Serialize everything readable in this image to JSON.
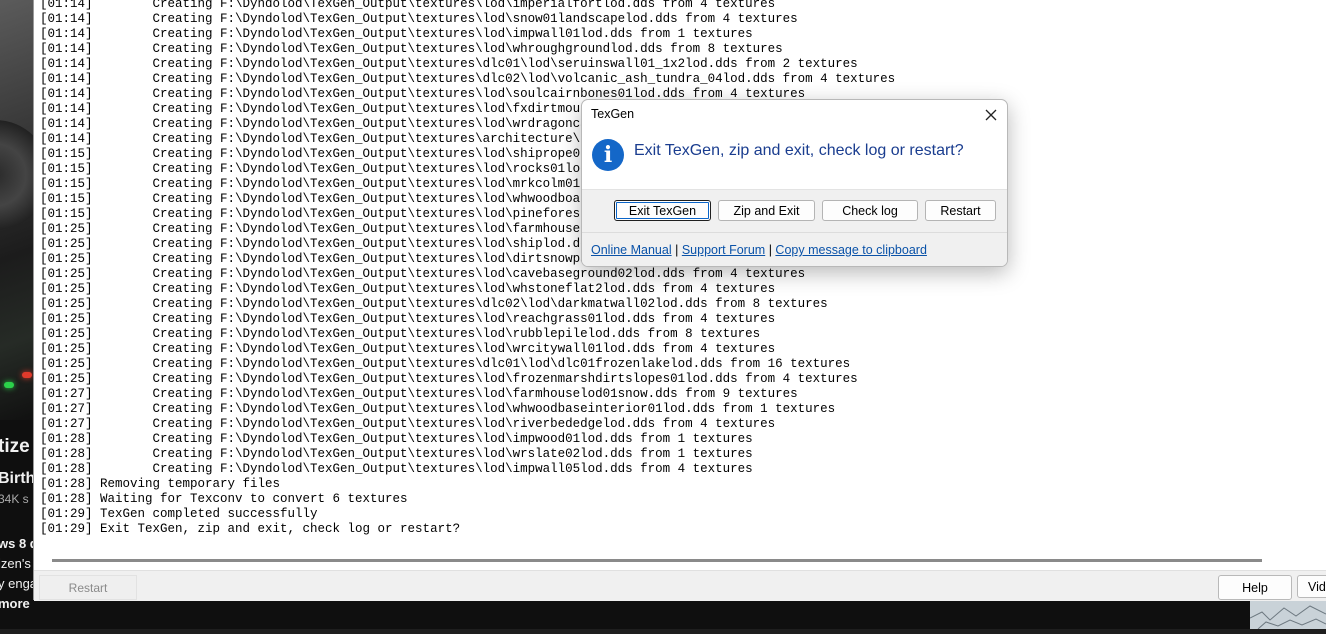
{
  "background": {
    "video_title_fragment": "tize",
    "subtitle_fragment": "Birth",
    "meta_fragment": "34K s",
    "desc_line1": "ws 8 d",
    "desc_line2": "izen's",
    "desc_line3": "y enga",
    "more_label": "more"
  },
  "log": {
    "lines": [
      "[01:14]        Creating F:\\Dyndolod\\TexGen_Output\\textures\\lod\\imperialfortlod.dds from 4 textures",
      "[01:14]        Creating F:\\Dyndolod\\TexGen_Output\\textures\\lod\\snow01landscapelod.dds from 4 textures",
      "[01:14]        Creating F:\\Dyndolod\\TexGen_Output\\textures\\lod\\impwall01lod.dds from 1 textures",
      "[01:14]        Creating F:\\Dyndolod\\TexGen_Output\\textures\\lod\\whroughgroundlod.dds from 8 textures",
      "[01:14]        Creating F:\\Dyndolod\\TexGen_Output\\textures\\dlc01\\lod\\seruinswall01_1x2lod.dds from 2 textures",
      "[01:14]        Creating F:\\Dyndolod\\TexGen_Output\\textures\\dlc02\\lod\\volcanic_ash_tundra_04lod.dds from 4 textures",
      "[01:14]        Creating F:\\Dyndolod\\TexGen_Output\\textures\\lod\\soulcairnbones01lod.dds from 4 textures",
      "[01:14]        Creating F:\\Dyndolod\\TexGen_Output\\textures\\lod\\fxdirtmound01l",
      "[01:14]        Creating F:\\Dyndolod\\TexGen_Output\\textures\\lod\\wrdragoncarvin",
      "[01:14]        Creating F:\\Dyndolod\\TexGen_Output\\textures\\architecture\\highh",
      "[01:15]        Creating F:\\Dyndolod\\TexGen_Output\\textures\\lod\\shiprope01lod.",
      "[01:15]        Creating F:\\Dyndolod\\TexGen_Output\\textures\\lod\\rocks01lod.dds",
      "[01:15]        Creating F:\\Dyndolod\\TexGen_Output\\textures\\lod\\mrkcolm01lod.d",
      "[01:15]        Creating F:\\Dyndolod\\TexGen_Output\\textures\\lod\\whwoodboards01",
      "[01:15]        Creating F:\\Dyndolod\\TexGen_Output\\textures\\lod\\pineforest02lo",
      "[01:25]        Creating F:\\Dyndolod\\TexGen_Output\\textures\\lod\\farmhouselod01",
      "[01:25]        Creating F:\\Dyndolod\\TexGen_Output\\textures\\lod\\shiplod.dds fr",
      "[01:25]        Creating F:\\Dyndolod\\TexGen_Output\\textures\\lod\\dirtsnowpath01",
      "[01:25]        Creating F:\\Dyndolod\\TexGen_Output\\textures\\lod\\cavebaseground02lod.dds from 4 textures",
      "[01:25]        Creating F:\\Dyndolod\\TexGen_Output\\textures\\lod\\whstoneflat2lod.dds from 4 textures",
      "[01:25]        Creating F:\\Dyndolod\\TexGen_Output\\textures\\dlc02\\lod\\darkmatwall02lod.dds from 8 textures",
      "[01:25]        Creating F:\\Dyndolod\\TexGen_Output\\textures\\lod\\reachgrass01lod.dds from 4 textures",
      "[01:25]        Creating F:\\Dyndolod\\TexGen_Output\\textures\\lod\\rubblepilelod.dds from 8 textures",
      "[01:25]        Creating F:\\Dyndolod\\TexGen_Output\\textures\\lod\\wrcitywall01lod.dds from 4 textures",
      "[01:25]        Creating F:\\Dyndolod\\TexGen_Output\\textures\\dlc01\\lod\\dlc01frozenlakelod.dds from 16 textures",
      "[01:25]        Creating F:\\Dyndolod\\TexGen_Output\\textures\\lod\\frozenmarshdirtslopes01lod.dds from 4 textures",
      "[01:27]        Creating F:\\Dyndolod\\TexGen_Output\\textures\\lod\\farmhouselod01snow.dds from 9 textures",
      "[01:27]        Creating F:\\Dyndolod\\TexGen_Output\\textures\\lod\\whwoodbaseinterior01lod.dds from 1 textures",
      "[01:27]        Creating F:\\Dyndolod\\TexGen_Output\\textures\\lod\\riverbededgelod.dds from 4 textures",
      "[01:28]        Creating F:\\Dyndolod\\TexGen_Output\\textures\\lod\\impwood01lod.dds from 1 textures",
      "[01:28]        Creating F:\\Dyndolod\\TexGen_Output\\textures\\lod\\wrslate02lod.dds from 1 textures",
      "[01:28]        Creating F:\\Dyndolod\\TexGen_Output\\textures\\lod\\impwall05lod.dds from 4 textures",
      "[01:28] Removing temporary files",
      "[01:28] Waiting for Texconv to convert 6 textures",
      "[01:29] TexGen completed successfully",
      "[01:29] Exit TexGen, zip and exit, check log or restart?"
    ]
  },
  "bottom_bar": {
    "restart_label": "Restart",
    "help_label": "Help",
    "video_label": "Vid"
  },
  "dialog": {
    "title": "TexGen",
    "icon": "info-icon",
    "icon_glyph": "i",
    "close_glyph": "✕",
    "message": "Exit TexGen, zip and exit, check log or restart?",
    "buttons": {
      "exit": "Exit TexGen",
      "zip_exit": "Zip and Exit",
      "check_log": "Check log",
      "restart": "Restart"
    },
    "links": {
      "manual": "Online Manual",
      "forum": "Support Forum",
      "copy": "Copy message to clipboard",
      "separator": "|"
    }
  },
  "colors": {
    "info_icon": "#1467c8",
    "message_text": "#1a3d8f",
    "link": "#0a52a8",
    "default_button_focus": "#0a64c8"
  }
}
